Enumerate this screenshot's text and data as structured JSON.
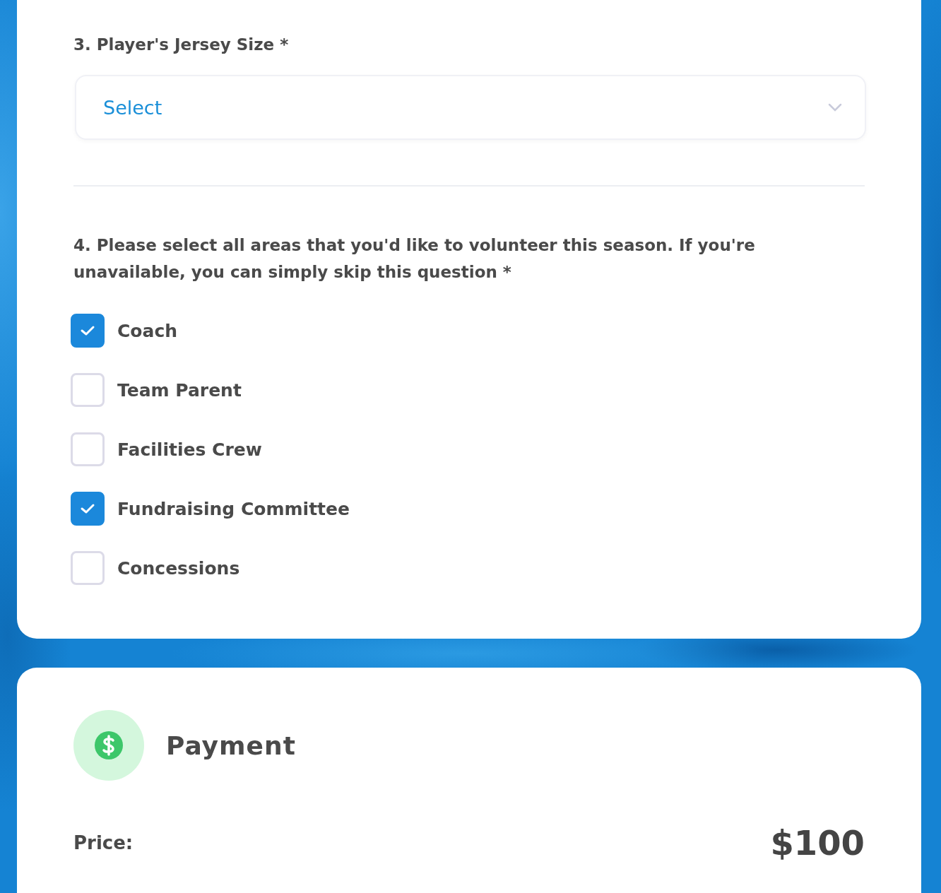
{
  "jersey": {
    "label": "3. Player's Jersey Size *",
    "placeholder": "Select"
  },
  "volunteer": {
    "label": "4. Please select all areas that you'd like to volunteer this season. If you're unavailable, you can simply skip this question *",
    "options": [
      {
        "label": "Coach",
        "checked": true
      },
      {
        "label": "Team Parent",
        "checked": false
      },
      {
        "label": "Facilities Crew",
        "checked": false
      },
      {
        "label": "Fundraising Committee",
        "checked": true
      },
      {
        "label": "Concessions",
        "checked": false
      }
    ]
  },
  "payment": {
    "title": "Payment",
    "price_label": "Price:",
    "price": "$100"
  }
}
